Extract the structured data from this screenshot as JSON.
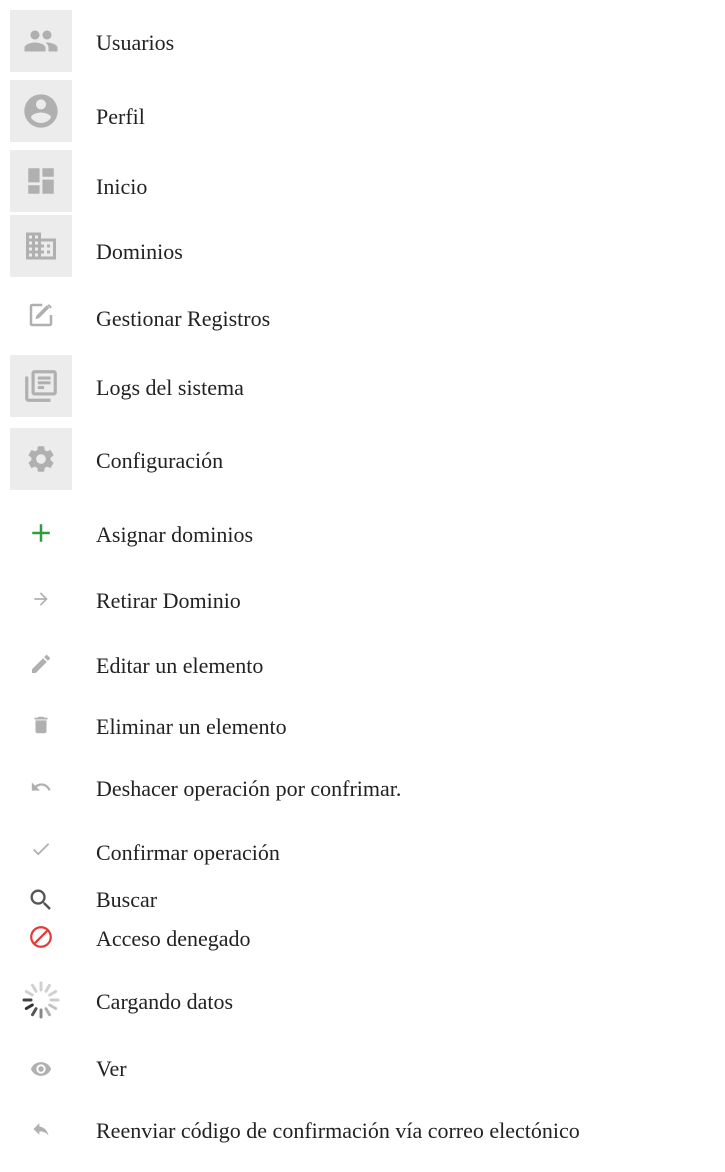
{
  "legend": [
    {
      "label": "Usuarios",
      "icon": "people-icon"
    },
    {
      "label": "Perfil",
      "icon": "account-circle-icon"
    },
    {
      "label": "Inicio",
      "icon": "dashboard-icon"
    },
    {
      "label": "Dominios",
      "icon": "domain-icon"
    },
    {
      "label": "Gestionar Registros",
      "icon": "edit-note-icon"
    },
    {
      "label": "Logs del sistema",
      "icon": "library-books-icon"
    },
    {
      "label": "Configuración",
      "icon": "gear-icon"
    },
    {
      "label": "Asignar dominios",
      "icon": "plus-icon"
    },
    {
      "label": "Retirar Dominio",
      "icon": "arrow-right-icon"
    },
    {
      "label": "Editar un elemento",
      "icon": "pencil-icon"
    },
    {
      "label": "Eliminar un elemento",
      "icon": "trash-icon"
    },
    {
      "label": "Deshacer operación por confrimar.",
      "icon": "undo-icon"
    },
    {
      "label": "Confirmar operación",
      "icon": "check-icon"
    },
    {
      "label": "Buscar",
      "icon": "search-icon"
    },
    {
      "label": "Acceso denegado",
      "icon": "block-icon"
    },
    {
      "label": "Cargando datos",
      "icon": "spinner-icon"
    },
    {
      "label": "Ver",
      "icon": "eye-icon"
    },
    {
      "label": "Reenviar código de confirmación vía correo electónico",
      "icon": "reply-icon"
    }
  ],
  "colors": {
    "icon_gray": "#b0b0b0",
    "tile_bg": "#ececec",
    "plus_green": "#2e9d3a",
    "deny_red": "#e53935"
  }
}
